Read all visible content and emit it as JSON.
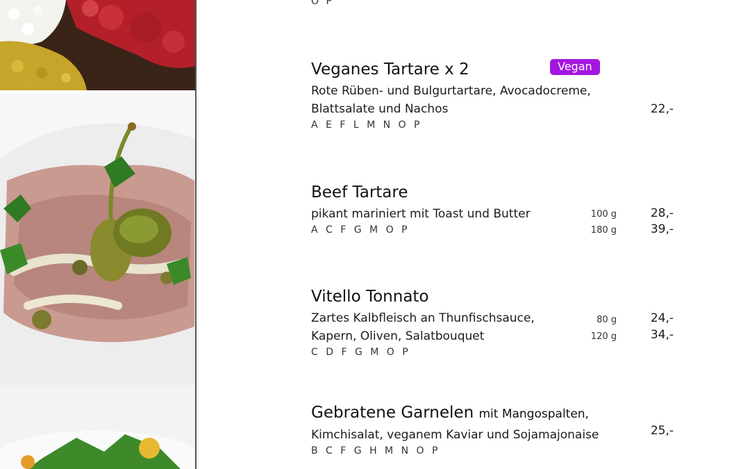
{
  "top_allergens": "O P",
  "items": [
    {
      "title": "Veganes Tartare x 2",
      "badge": "Vegan",
      "desc_lines": [
        "Rote Rüben- und Bulgurtartare, Avocadocreme,",
        "Blattsalate und Nachos"
      ],
      "allergens": "A E F L M N O P",
      "prices": [
        "22,-"
      ]
    },
    {
      "title": "Beef Tartare",
      "desc_lines": [
        "pikant mariniert mit Toast und Butter"
      ],
      "allergens": "A C F G M O P",
      "weights": [
        "100 g",
        "180 g"
      ],
      "prices": [
        "28,-",
        "39,-"
      ]
    },
    {
      "title": "Vitello Tonnato",
      "desc_lines": [
        "Zartes Kalbfleisch an Thunfischsauce,",
        "Kapern, Oliven, Salatbouquet"
      ],
      "allergens": "C D F G M O P",
      "weights": [
        "80 g",
        "120 g"
      ],
      "prices": [
        "24,-",
        "34,-"
      ]
    },
    {
      "title": "Gebratene Garnelen",
      "title_suffix": "mit Mangospalten,",
      "desc_lines": [
        "Kimchisalat, veganem Kaviar und Sojamajonaise"
      ],
      "allergens": "B C F G H M N O P",
      "prices": [
        "25,-"
      ]
    }
  ],
  "colors": {
    "vegan_badge": "#a316e0"
  }
}
